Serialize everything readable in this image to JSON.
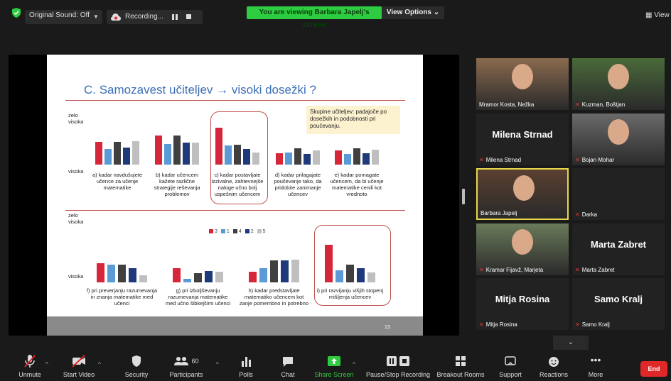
{
  "topbar": {
    "original_sound": "Original Sound: Off",
    "recording": "Recording...",
    "viewing_banner": "You are viewing Barbara Japelj's screen",
    "view_options": "View Options ⌄",
    "view": "View",
    "colors": {
      "banner": "#2ecc40",
      "end": "#e02828",
      "active_speaker": "#e8d84a"
    }
  },
  "slide": {
    "title": "C. Samozavest učiteljev → visoki dosežki ?",
    "note": "Skupine učiteljev: padajoče po dosežkih in podobnosti pri poučevanju.",
    "axis_top_1": "zelo visoka",
    "axis_bottom_1": "visoka",
    "axis_top_2": "zelo visoka",
    "axis_bottom_2": "visoka",
    "page_number": "13",
    "legend": [
      "3",
      "1",
      "4",
      "2",
      "5"
    ],
    "legend_colors": [
      "#d6263a",
      "#5b9bd5",
      "#404040",
      "#1f3a7a",
      "#bfbfbf"
    ],
    "top_categories": [
      "a) kadar navdušujete učence za učenje matematike",
      "b) kadar učencem kažete različne strategije reševanja problemov",
      "c) kadar postavljate izzivalne, zahtevnejše naloge učno bolj uspešnim učencem",
      "d) kadar prilagajate poučevanje tako, da pridobite zanimanje učencev",
      "e) kadar pomagate učencem, da bi učenje matematike cenili kot vrednoto"
    ],
    "bottom_categories": [
      "f) pri preverjanju razumevanja in znanja matematike med učenci",
      "g) pri izboljševanju razumevanja matematike med učno šibkejšimi učenci",
      "h) kadar predstavljate matematiko učencem kot zanje pomembno in potrebno",
      "i) pri razvijanju višjih stopenj mišljenja učencev"
    ],
    "top_values": [
      [
        0.62,
        0.43,
        0.62,
        0.46,
        0.64
      ],
      [
        0.79,
        0.56,
        0.78,
        0.6,
        0.6
      ],
      [
        1.0,
        0.52,
        0.53,
        0.42,
        0.32
      ],
      [
        0.31,
        0.33,
        0.44,
        0.28,
        0.38
      ],
      [
        0.38,
        0.29,
        0.44,
        0.31,
        0.4
      ]
    ],
    "bottom_values": [
      [
        0.48,
        0.45,
        0.45,
        0.36,
        0.18
      ],
      [
        0.36,
        0.09,
        0.24,
        0.29,
        0.27
      ],
      [
        0.27,
        0.36,
        0.55,
        0.55,
        0.58
      ],
      [
        0.95,
        0.3,
        0.45,
        0.35,
        0.25
      ]
    ]
  },
  "gallery": [
    {
      "name": "Mramor Kosta, Nežka",
      "muted": false,
      "video": true
    },
    {
      "name": "Kuzman, Boštjan",
      "muted": true,
      "video": true
    },
    {
      "name": "Milena Strnad",
      "bigname": "Milena Strnad",
      "muted": true,
      "video": false
    },
    {
      "name": "Bojan Mohar",
      "muted": true,
      "video": true
    },
    {
      "name": "Barbara Japelj",
      "muted": false,
      "video": true
    },
    {
      "name": "Darka",
      "muted": true,
      "video": false
    },
    {
      "name": "Kramar Fijavž, Marjeta",
      "muted": true,
      "video": true
    },
    {
      "name": "Marta Zabret",
      "bigname": "Marta Zabret",
      "muted": true,
      "video": false
    },
    {
      "name": "Mitja Rosina",
      "bigname": "Mitja Rosina",
      "muted": true,
      "video": false
    },
    {
      "name": "Samo Kralj",
      "bigname": "Samo Kralj",
      "muted": true,
      "video": false
    }
  ],
  "toolbar": {
    "unmute": "Unmute",
    "start_video": "Start Video",
    "security": "Security",
    "participants": "Participants",
    "participants_count": "60",
    "polls": "Polls",
    "chat": "Chat",
    "share_screen": "Share Screen",
    "pause_recording": "Pause/Stop Recording",
    "breakout": "Breakout Rooms",
    "support": "Support",
    "reactions": "Reactions",
    "more": "More",
    "end": "End"
  }
}
